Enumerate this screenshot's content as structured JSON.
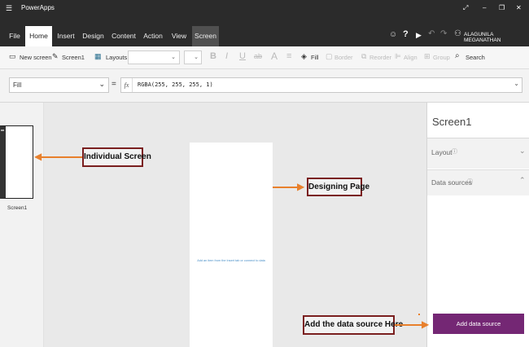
{
  "app": {
    "title": "PowerApps",
    "hamburger_icon": "hamburger-icon",
    "window_controls": [
      "expand-icon",
      "minimize-icon",
      "restore-icon",
      "close-icon"
    ]
  },
  "menu": {
    "tabs": [
      "File",
      "Home",
      "Insert",
      "Design",
      "Content",
      "Action",
      "View",
      "Screen"
    ],
    "active_tab": "Home",
    "right_icons": [
      "smiley-icon",
      "help-icon",
      "play-icon",
      "undo-icon",
      "redo-icon",
      "user-icon"
    ],
    "user_name": "ALAGUNILA MEGANATHAN"
  },
  "toolbar": {
    "new_screen": "New screen",
    "screen_name": "Screen1",
    "layouts": "Layouts",
    "bold": "B",
    "italic": "I",
    "underline": "U",
    "strike": "ab",
    "font_size_glyph": "A",
    "align_glyph": "≡",
    "fill": "Fill",
    "border": "Border",
    "reorder": "Reorder",
    "align": "Align",
    "group": "Group",
    "search": "Search"
  },
  "formula_bar": {
    "property": "Fill",
    "equals": "=",
    "fx": "fx",
    "formula": "RGBA(255, 255, 255, 1)"
  },
  "screens_pane": {
    "thumbnail_label": "Screen1"
  },
  "canvas": {
    "placeholder": "Add an item from the Insert tab or connect to data"
  },
  "properties_pane": {
    "title": "Screen1",
    "layout_label": "Layout",
    "data_sources_label": "Data sources",
    "add_button": "Add data source"
  },
  "annotations": {
    "individual_screen": "Individual Screen",
    "designing_page": "Designing Page",
    "add_data_source": "Add the data source Here"
  },
  "colors": {
    "title_bar": "#2b2b2b",
    "accent_purple": "#742774",
    "annotation_arrow": "#e8802c",
    "annotation_border": "#7a1f1f"
  }
}
